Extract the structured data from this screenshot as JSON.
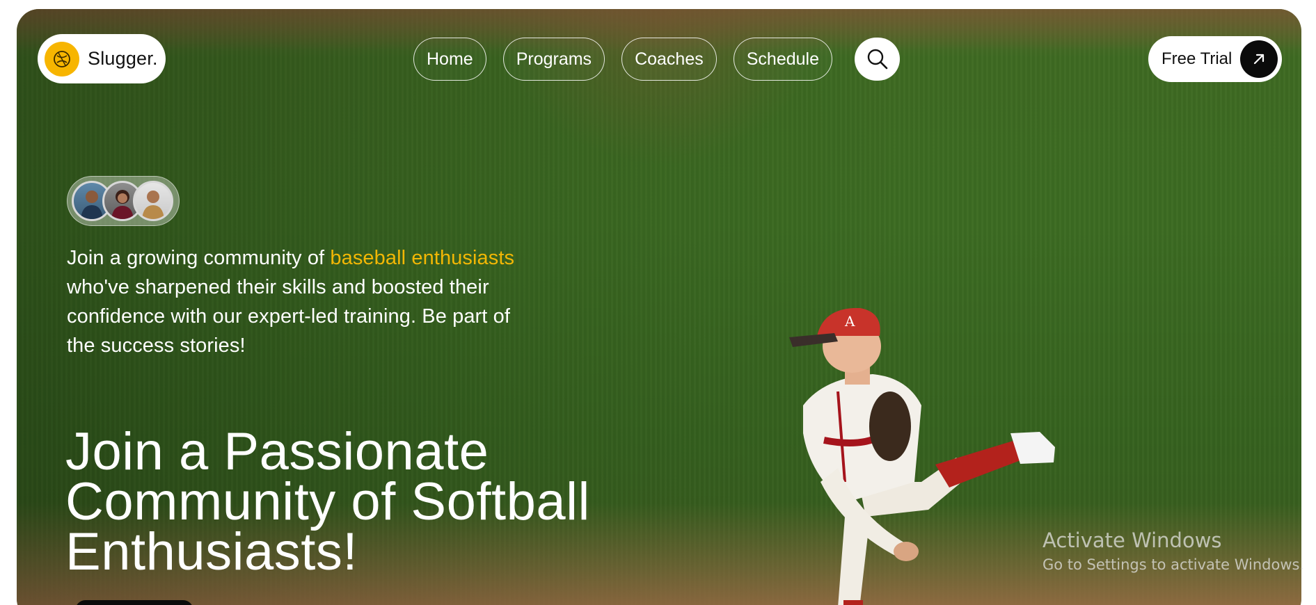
{
  "brand": {
    "name": "Slugger.",
    "accent_color": "#f7b500"
  },
  "nav": {
    "items": [
      {
        "label": "Home"
      },
      {
        "label": "Programs"
      },
      {
        "label": "Coaches"
      },
      {
        "label": "Schedule"
      }
    ],
    "search_icon": "search-icon",
    "cta": {
      "label": "Free Trial",
      "icon": "arrow-up-right-icon"
    }
  },
  "community": {
    "avatar_count": 3,
    "blurb_pre": "Join a growing community of ",
    "blurb_highlight": "baseball enthusiasts",
    "blurb_post": " who've sharpened their skills and boosted their confidence with our expert-led training. Be part of the success stories!",
    "highlight_color": "#f2b705"
  },
  "hero": {
    "headline": "Join a Passionate Community of Softball Enthusiasts!"
  },
  "watermark": {
    "title": "Activate Windows",
    "subtitle": "Go to Settings to activate Windows."
  }
}
